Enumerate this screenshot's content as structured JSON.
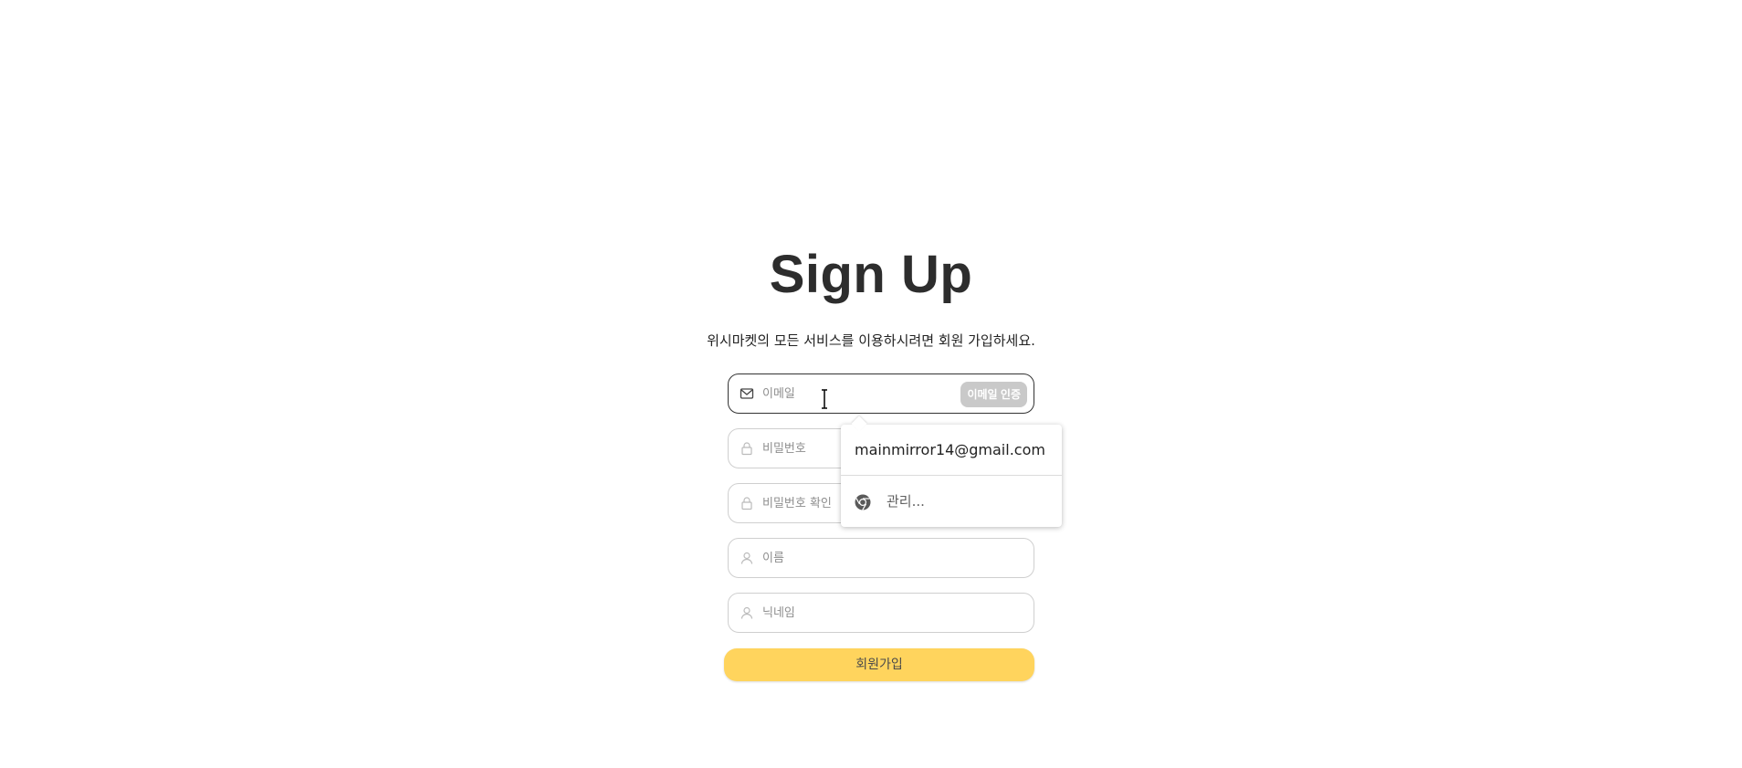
{
  "title": "Sign Up",
  "subtitle": "위시마켓의 모든 서비스를 이용하시려면 회원 가입하세요.",
  "form": {
    "email_placeholder": "이메일",
    "email_verify_label": "이메일 인증",
    "password_placeholder": "비밀번호",
    "password_confirm_placeholder": "비밀번호 확인",
    "name_placeholder": "이름",
    "nickname_placeholder": "닉네임",
    "submit_label": "회원가입"
  },
  "autofill": {
    "suggestion": "mainmirror14@gmail.com",
    "manage_label": "관리..."
  },
  "icons": {
    "email": "mail-icon",
    "password": "lock-icon",
    "password_confirm": "lock-icon",
    "name": "user-icon",
    "nickname": "user-icon",
    "manage": "chrome-icon"
  },
  "colors": {
    "submit_bg": "#ffd45d",
    "verify_bg": "#c9c9c9",
    "title": "#2d2d2d"
  }
}
